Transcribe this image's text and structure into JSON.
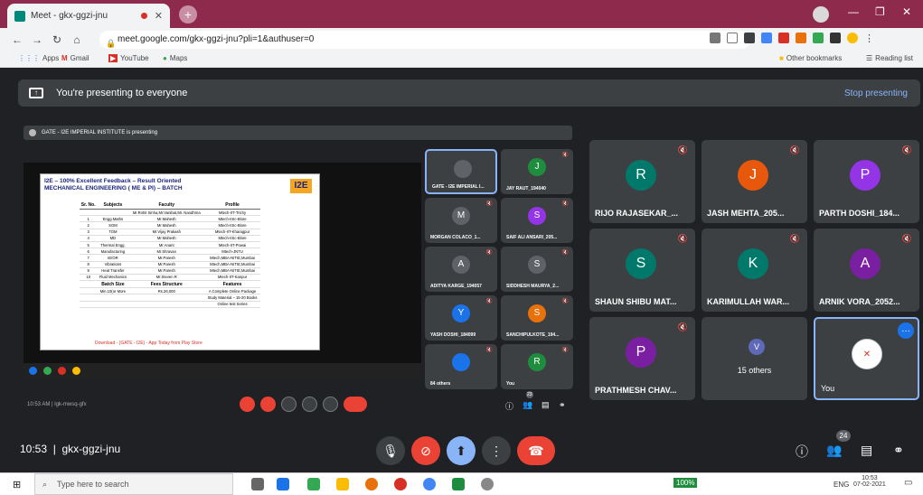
{
  "browser": {
    "tab_title": "Meet - gkx-ggzi-jnu",
    "url": "meet.google.com/gkx-ggzi-jnu?pli=1&authuser=0",
    "bookmarks": [
      "Apps",
      "Gmail",
      "YouTube",
      "Maps"
    ],
    "other_bookmarks": "Other bookmarks",
    "reading_list": "Reading list"
  },
  "meet": {
    "presenting_banner": "You're presenting to everyone",
    "stop_presenting": "Stop presenting",
    "share_info": "GATE - I2E IMPERIAL INSTITUTE is presenting",
    "share_meta": "10:53 AM | lgk-mwsq-gfx",
    "time": "10:53",
    "meeting_code": "gkx-ggzi-jnu",
    "participant_count": "24",
    "mini_count": "23"
  },
  "slide": {
    "title": "I2E – 100% Excellent Feedback – Result Oriented",
    "subtitle": "MECHANICAL ENGINEERING ( ME & PI) – BATCH",
    "logo": "I2E",
    "headers": [
      "Sr. No.",
      "Subjects",
      "Faculty",
      "Profile"
    ],
    "rows": [
      [
        "",
        "",
        "Mr.Rohit Sinha,Mr.Vanibat,Mr. Nandhrna",
        "Mtech-IIT-Trichy"
      ],
      [
        "1",
        "Engg.Maths",
        "Mr.Mahesh",
        "Mtech-IISc-Blore"
      ],
      [
        "2",
        "SOM",
        "Mr.Mahesh",
        "Mtech-IISc-Blore"
      ],
      [
        "3",
        "TOM",
        "Mr.Vijay Prakash",
        "Mtech-IIT-Kharagpur"
      ],
      [
        "4",
        "MD",
        "Mr.Mahesh",
        "Mtech-IISc-Blore"
      ],
      [
        "5",
        "Thermal Engg.",
        "Mr.Anant",
        "Mtech-IIT-Powai"
      ],
      [
        "6",
        "Manufacturing",
        "Mr.Shravan",
        "Mtech-JNTU"
      ],
      [
        "7",
        "IE/OR",
        "Mr.Paresh",
        "Mtech,MBA-NITIE,Mumbai"
      ],
      [
        "8",
        "Vibrations",
        "Mr.Paresh",
        "Mtech,MBA-NITIE,Mumbai"
      ],
      [
        "9",
        "Heat Transfer",
        "Mr.Paresh",
        "Mtech,MBA-NITIE,Mumbai"
      ],
      [
        "10",
        "Fluid Mechanics",
        "Mr.Steven R",
        "Mtech-IIT-Kanpur"
      ]
    ],
    "footer_headers": [
      "Batch Size",
      "Fees Structure",
      "Features"
    ],
    "footer_rows": [
      [
        "Min.10(or More",
        "Rs.26,000",
        "A Complete Online Package"
      ],
      [
        "",
        "",
        "Study Material – 15-20 Books"
      ],
      [
        "",
        "",
        "Online test Series"
      ]
    ],
    "download": "Download - (GATE - I2E) - App Today from Play Store"
  },
  "mini_tiles": [
    {
      "name": "GATE - I2E IMPERIAL I...",
      "initial": "",
      "color": "#5f6368"
    },
    {
      "name": "JAY RAUT_194040",
      "initial": "J",
      "color": "#1e8e3e"
    },
    {
      "name": "MORGAN COLACO_1...",
      "initial": "M",
      "color": "#5f6368"
    },
    {
      "name": "SAIF ALI ANSARI_205...",
      "initial": "S",
      "color": "#9334e6"
    },
    {
      "name": "ADITYA KARGE_194057",
      "initial": "A",
      "color": "#5f6368"
    },
    {
      "name": "SIDDHESH MAURYA_2...",
      "initial": "S",
      "color": "#5f6368"
    },
    {
      "name": "YASH DOSHI_184099",
      "initial": "Y",
      "color": "#1a73e8"
    },
    {
      "name": "SANCHIPULKOTE_194...",
      "initial": "S",
      "color": "#e8710a"
    },
    {
      "name": "84 others",
      "initial": "",
      "color": "#1a73e8"
    },
    {
      "name": "You",
      "initial": "R",
      "color": "#1e8e3e"
    }
  ],
  "tiles": [
    {
      "name": "RIJO RAJASEKAR_...",
      "initial": "R",
      "color": "#00796b"
    },
    {
      "name": "JASH MEHTA_205...",
      "initial": "J",
      "color": "#e8580c"
    },
    {
      "name": "PARTH DOSHI_184...",
      "initial": "P",
      "color": "#9334e6"
    },
    {
      "name": "SHAUN SHIBU MAT...",
      "initial": "S",
      "color": "#00796b"
    },
    {
      "name": "KARIMULLAH WAR...",
      "initial": "K",
      "color": "#00796b"
    },
    {
      "name": "ARNIK VORA_2052...",
      "initial": "A",
      "color": "#7b1fa2"
    },
    {
      "name": "PRATHMESH CHAV...",
      "initial": "P",
      "color": "#7b1fa2"
    },
    {
      "name": "15 others",
      "initial": "V",
      "color": "#5f6368"
    },
    {
      "name": "You",
      "initial": "",
      "color": "#ffffff"
    }
  ],
  "taskbar": {
    "search_placeholder": "Type here to search",
    "battery": "100%",
    "lang": "ENG",
    "time": "10:53",
    "date": "07-02-2021"
  }
}
